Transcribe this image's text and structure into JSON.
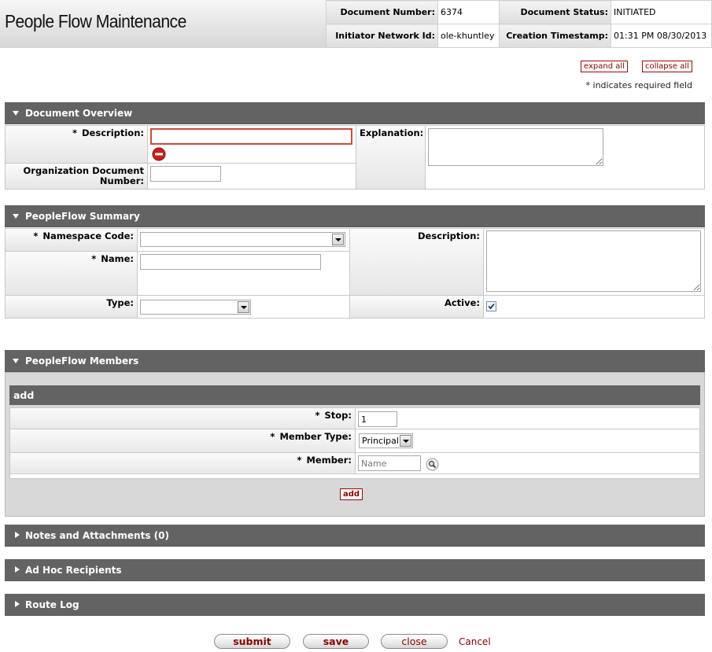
{
  "header": {
    "title": "People Flow Maintenance",
    "doc_number_label": "Document Number:",
    "doc_number": "6374",
    "doc_status_label": "Document Status:",
    "doc_status": "INITIATED",
    "initiator_label": "Initiator Network Id:",
    "initiator": "ole-khuntley",
    "timestamp_label": "Creation Timestamp:",
    "timestamp": "01:31 PM 08/30/2013"
  },
  "controls": {
    "expand_all": "expand all",
    "collapse_all": "collapse all",
    "required_note": "* indicates required field"
  },
  "document_overview": {
    "title": "Document Overview",
    "description_label": "Description:",
    "description_value": "",
    "explanation_label": "Explanation:",
    "explanation_value": "",
    "org_doc_number_label": "Organization Document Number:",
    "org_doc_number_value": ""
  },
  "peopleflow_summary": {
    "title": "PeopleFlow Summary",
    "namespace_label": "Namespace Code:",
    "namespace_value": "",
    "name_label": "Name:",
    "name_value": "",
    "type_label": "Type:",
    "type_value": "",
    "description_label": "Description:",
    "description_value": "",
    "active_label": "Active:",
    "active_checked": true
  },
  "peopleflow_members": {
    "title": "PeopleFlow Members",
    "add_header": "add",
    "stop_label": "Stop:",
    "stop_value": "1",
    "member_type_label": "Member Type:",
    "member_type_value": "Principal",
    "member_label": "Member:",
    "member_placeholder": "Name",
    "add_button": "add"
  },
  "collapsed_sections": {
    "notes": "Notes and Attachments (0)",
    "adhoc": "Ad Hoc Recipients",
    "route_log": "Route Log"
  },
  "actions": {
    "submit": "submit",
    "save": "save",
    "close": "close",
    "cancel": "Cancel"
  },
  "required_marker": "*",
  "icons": {
    "error": "error-icon",
    "lookup": "magnifier-lookup-icon",
    "checkbox": "checkbox-checked-icon"
  },
  "colors": {
    "tab_background": "#636363",
    "error_border": "#d24a3a",
    "link_red": "#8b0000"
  }
}
